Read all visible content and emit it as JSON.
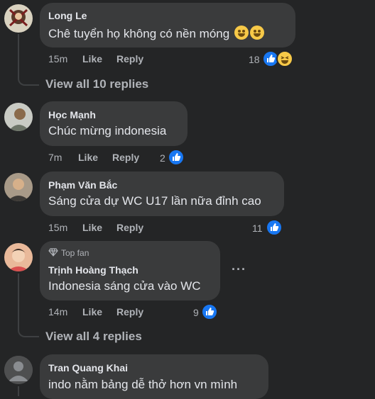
{
  "comments": [
    {
      "name": "Long Le",
      "text": "Chê tuyển họ không có nền móng",
      "emojis": [
        "grinning-tears-emoji",
        "grinning-tears-emoji"
      ],
      "time": "15m",
      "like_label": "Like",
      "reply_label": "Reply",
      "reaction_count": "18",
      "reactions": [
        "like",
        "haha"
      ],
      "view_replies": "View all 10 replies"
    },
    {
      "name": "Học Mạnh",
      "text": "Chúc mừng indonesia",
      "time": "7m",
      "like_label": "Like",
      "reply_label": "Reply",
      "reaction_count": "2",
      "reactions": [
        "like"
      ]
    },
    {
      "name": "Phạm Văn Bắc",
      "text": "Sáng cửa dự WC U17 lần nữa đỉnh cao",
      "time": "15m",
      "like_label": "Like",
      "reply_label": "Reply",
      "reaction_count": "11",
      "reactions": [
        "like"
      ]
    },
    {
      "badge": "Top fan",
      "name": "Trịnh Hoàng Thạch",
      "text": "Indonesia sáng cửa vào WC",
      "time": "14m",
      "like_label": "Like",
      "reply_label": "Reply",
      "reaction_count": "9",
      "reactions": [
        "like"
      ],
      "more_label": "···",
      "view_replies": "View all 4 replies"
    },
    {
      "name": "Tran Quang Khai",
      "text": "indo nằm bảng dễ thở hơn vn mình"
    }
  ],
  "colors": {
    "background": "#242526",
    "bubble": "#3a3b3c",
    "like_blue": "#1877f2",
    "secondary_text": "#b0b3b8",
    "primary_text": "#e4e6eb"
  }
}
